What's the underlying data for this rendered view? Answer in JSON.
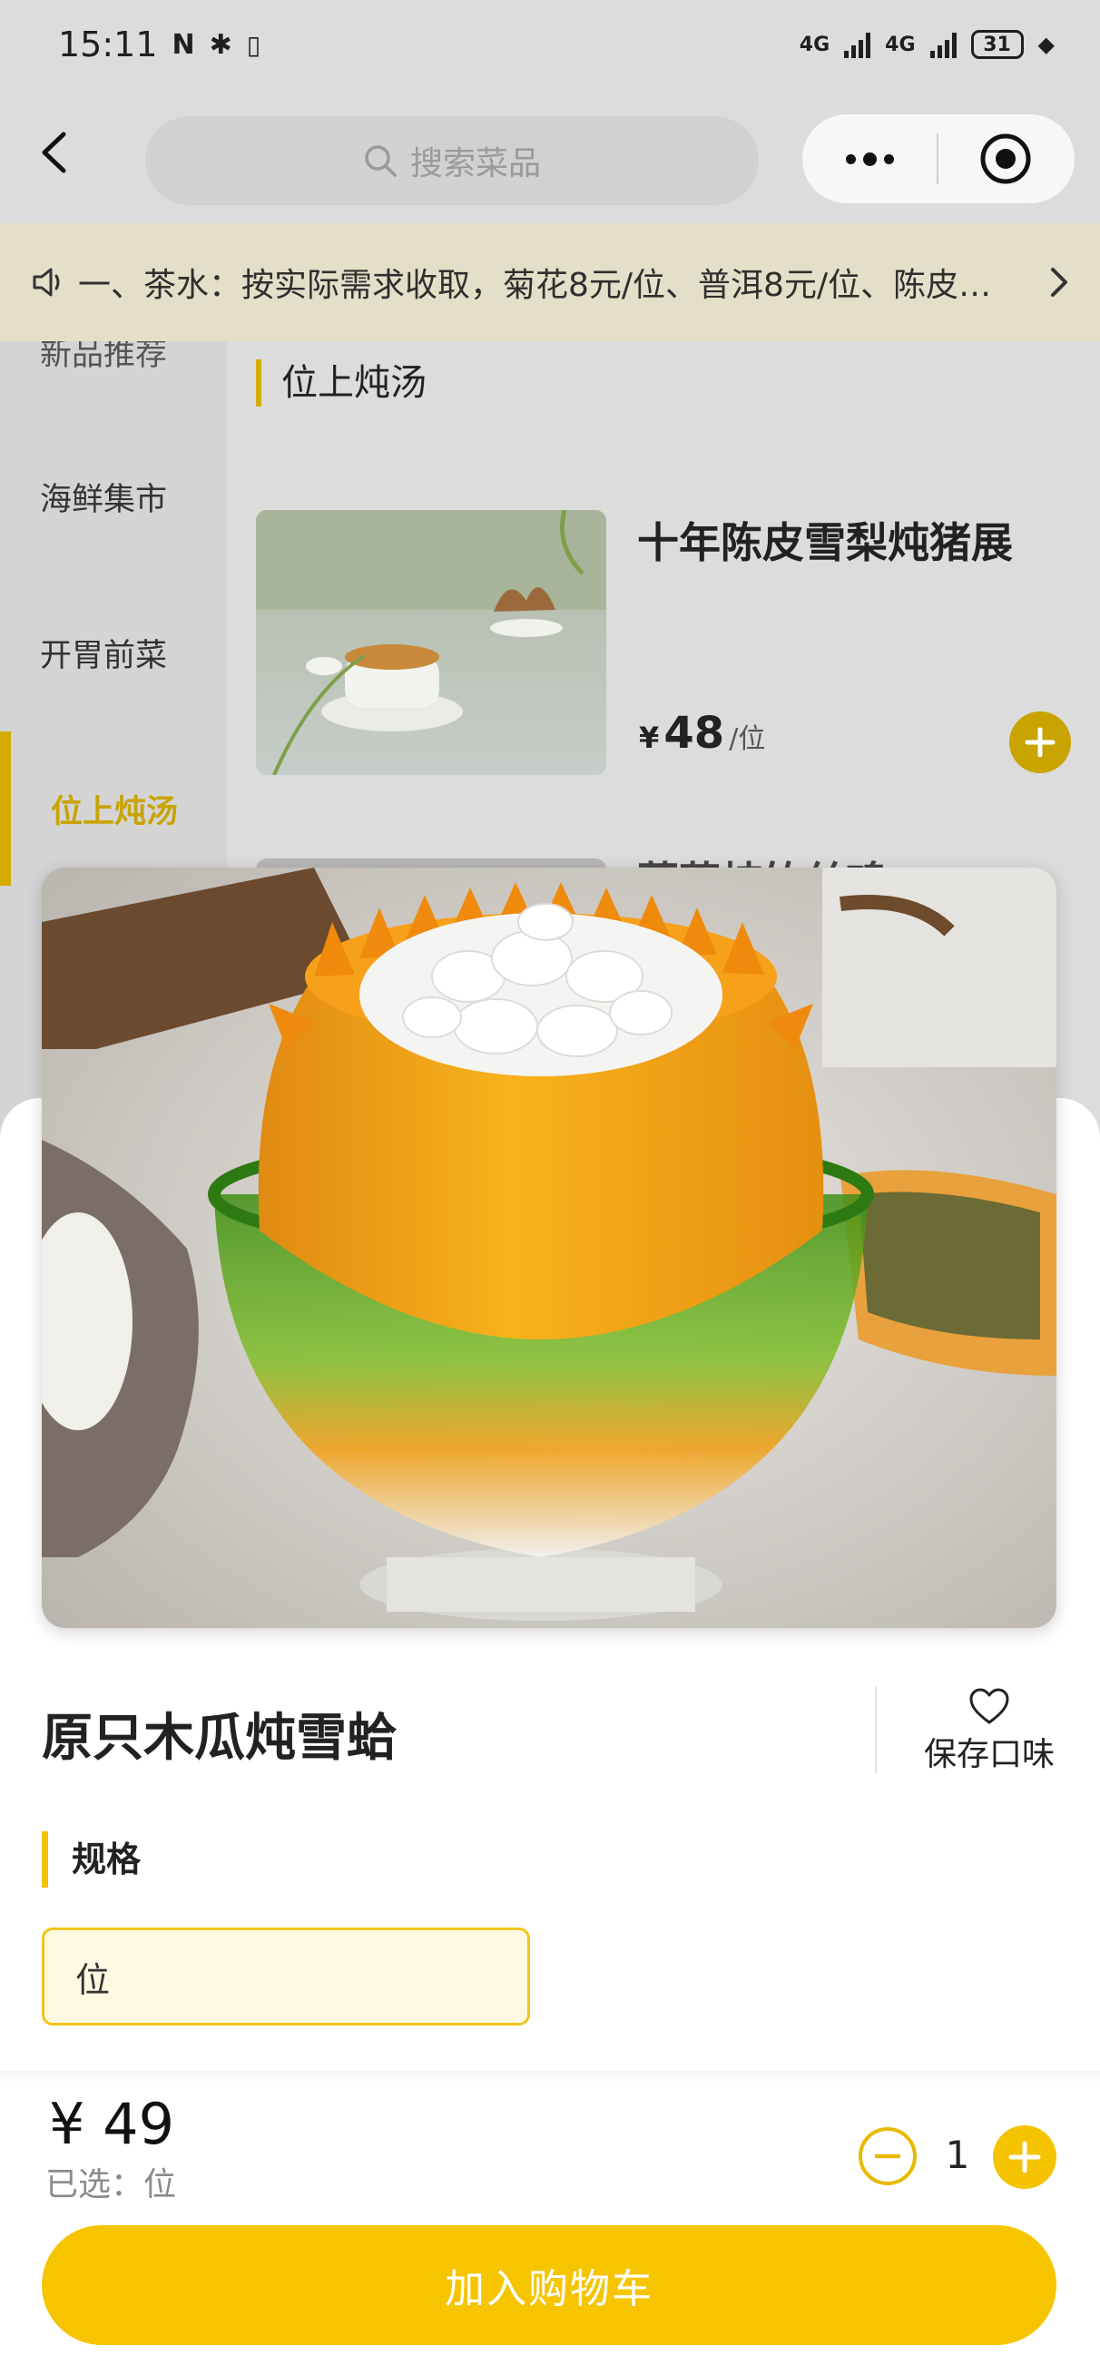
{
  "status_bar": {
    "time": "15:11",
    "network_1": "4G",
    "network_2": "4G",
    "battery": "31"
  },
  "nav": {
    "search_placeholder": "搜索菜品"
  },
  "notice": {
    "text": "一、茶水：按实际需求收取，菊花8元/位、普洱8元/位、陈皮…"
  },
  "categories": [
    {
      "label": "新品推荐"
    },
    {
      "label": "海鲜集市"
    },
    {
      "label": "开胃前菜"
    },
    {
      "label": "位上炖汤"
    },
    {
      "label": "…"
    }
  ],
  "menu": {
    "section_title": "位上炖汤",
    "dishes": [
      {
        "name": "十年陈皮雪梨炖猪展",
        "currency": "¥",
        "price": "48",
        "unit": "/位"
      },
      {
        "name": "菌菇炖竹丝鸡"
      }
    ]
  },
  "product": {
    "name": "原只木瓜炖雪蛤",
    "favorite_label": "保存口味",
    "spec_title": "规格",
    "spec_options": [
      {
        "label": "位",
        "selected": true
      }
    ],
    "price": "¥ 49",
    "selected_text": "已选：位",
    "quantity": "1",
    "add_to_cart": "加入购物车"
  },
  "colors": {
    "accent": "#F6C500",
    "accent_dim": "#C9A300",
    "spec_bg": "#FFF9E2"
  }
}
